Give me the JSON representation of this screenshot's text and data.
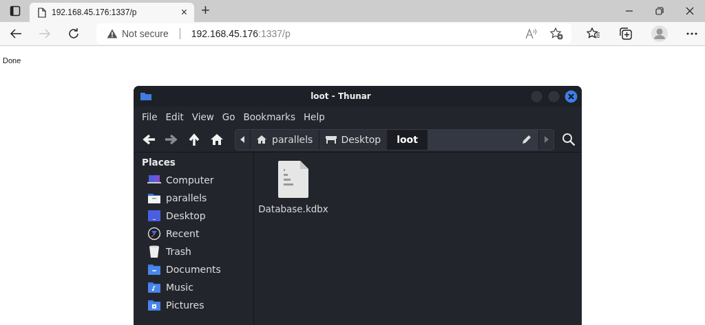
{
  "browser": {
    "tab": {
      "title": "192.168.45.176:1337/p",
      "close": "×"
    },
    "new_tab": "+",
    "address": {
      "security": "Not secure",
      "host": "192.168.45.176",
      "path": ":1337/p"
    }
  },
  "page": {
    "status": "Done"
  },
  "file_manager": {
    "title": "loot - Thunar",
    "menu": [
      "File",
      "Edit",
      "View",
      "Go",
      "Bookmarks",
      "Help"
    ],
    "nav": [
      {
        "kind": "back",
        "disabled": false
      },
      {
        "kind": "forward",
        "disabled": true
      },
      {
        "kind": "up",
        "disabled": false
      },
      {
        "kind": "home",
        "disabled": false
      }
    ],
    "path": [
      {
        "label": "parallels",
        "kind": "home",
        "selected": false
      },
      {
        "label": "Desktop",
        "kind": "desktop",
        "selected": false
      },
      {
        "label": "loot",
        "kind": "folder",
        "selected": true
      }
    ],
    "sidebar": {
      "heading": "Places",
      "items": [
        {
          "label": "Computer",
          "kind": "computer"
        },
        {
          "label": "parallels",
          "kind": "home"
        },
        {
          "label": "Desktop",
          "kind": "desktop"
        },
        {
          "label": "Recent",
          "kind": "recent"
        },
        {
          "label": "Trash",
          "kind": "trash"
        },
        {
          "label": "Documents",
          "kind": "documents"
        },
        {
          "label": "Music",
          "kind": "music"
        },
        {
          "label": "Pictures",
          "kind": "pictures"
        }
      ]
    },
    "files": [
      {
        "name": "Database.kdbx",
        "kind": "binary"
      }
    ]
  }
}
